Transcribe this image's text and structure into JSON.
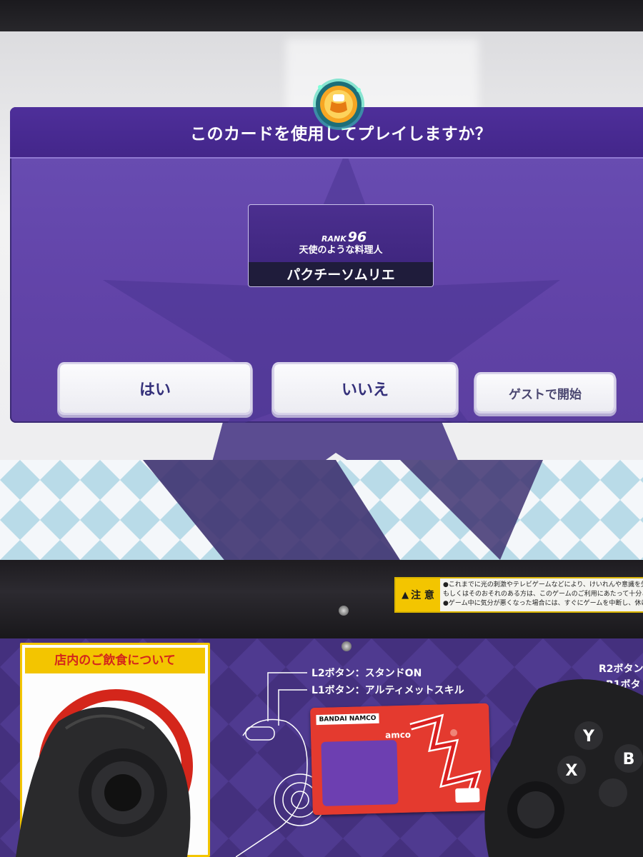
{
  "dialog": {
    "title": "このカードを使用してプレイしますか？"
  },
  "card": {
    "rank_label": "RANK",
    "rank_value": "96",
    "title": "天使のような料理人",
    "player_name": "パクチーソムリエ"
  },
  "buttons": {
    "yes": "はい",
    "no": "いいえ",
    "guest": "ゲストで開始"
  },
  "caution_sticker": {
    "heading": "注 意",
    "lines": [
      "●これまでに光の刺激やテレビゲームなどにより、けいれんや意識を失うなどの",
      "もしくはそのおそれのある方は、このゲームのご利用にあたって十分ご注意く",
      "●ゲーム中に気分が悪くなった場合には、すぐにゲームを中断し、休けいをおと"
    ]
  },
  "notice": {
    "heading": "店内のご飲食について"
  },
  "control_labels": {
    "l2": "L2ボタン：スタンドON",
    "l1": "L1ボタン：アルティメットスキル",
    "r2": "R2ボタン",
    "r1": "R1ボタ"
  },
  "promo_card": {
    "brand": "BANDAI NAMCO",
    "partial_text": "amco"
  },
  "colors": {
    "dialog_purple": "#6244a9",
    "header_purple": "#43268a",
    "button_text": "#34307a",
    "caution_yellow": "#f3c500"
  }
}
